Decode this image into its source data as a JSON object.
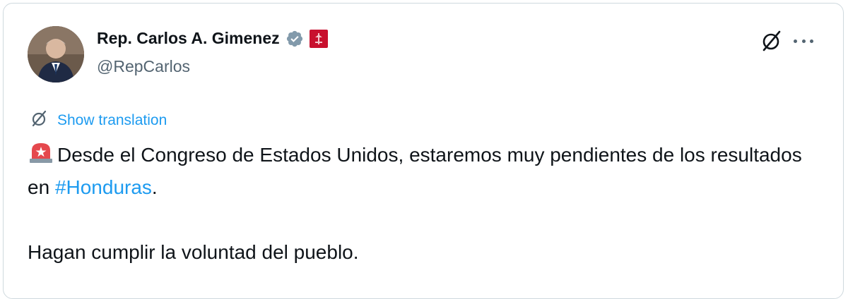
{
  "tweet": {
    "author": {
      "display_name": "Rep. Carlos A. Gimenez",
      "handle": "@RepCarlos",
      "verified_icon": "verified-badge-icon",
      "affiliation_icon": "us-house-flag-icon"
    },
    "actions": {
      "grok_icon": "grok-icon",
      "more_icon": "more-options-icon"
    },
    "translation": {
      "label": "Show translation"
    },
    "body": {
      "line1_prefix_icon": "siren-emoji",
      "line1_text": "Desde el Congreso de Estados Unidos, estaremos muy pendientes de los resultados en ",
      "hashtag": "#Honduras",
      "line1_suffix": ".",
      "line2_text": "Hagan cumplir la voluntad del pueblo."
    },
    "colors": {
      "link": "#1d9bf0",
      "text": "#0f1419",
      "secondary": "#536471",
      "verified": "#829aab",
      "flag": "#c8102e"
    }
  }
}
